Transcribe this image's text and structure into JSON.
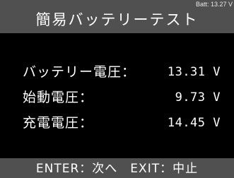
{
  "header": {
    "battery": "Batt: 13.27 V",
    "title": "簡易バッテリーテスト"
  },
  "readings": [
    {
      "label": "バッテリー電圧：",
      "value": "13.31 V"
    },
    {
      "label": "始動電圧：",
      "value": "9.73 V"
    },
    {
      "label": "充電電圧：",
      "value": "14.45 V"
    }
  ],
  "footer": {
    "text": "ENTER：次へ　EXIT：中止"
  }
}
